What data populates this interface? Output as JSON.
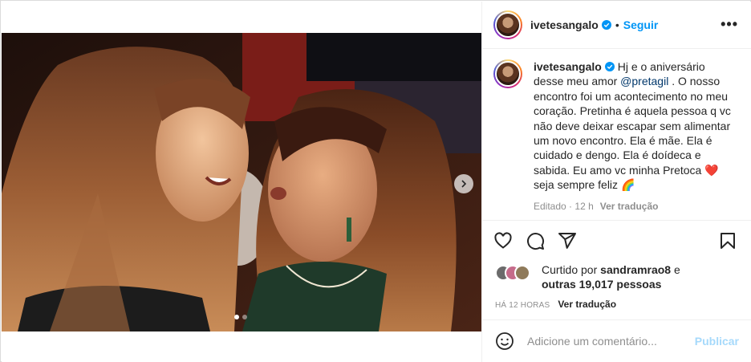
{
  "post": {
    "username": "ivetesangalo",
    "follow_label": "Seguir",
    "separator": "•",
    "more_label": "•••"
  },
  "caption": {
    "username": "ivetesangalo",
    "text_before_mention": "Hj e o aniversário desse meu amor ",
    "mention": "@pretagil",
    "text_after_mention": " . O nosso encontro foi um acontecimento no meu coração. Pretinha é aquela pessoa q vc não deve deixar escapar sem alimentar um novo encontro. Ela é mãe. Ela é cuidado e dengo. Ela é doídeca e sabida. Eu amo vc minha Pretoca ",
    "heart": "❤️",
    "text_end": " seja sempre feliz ",
    "rainbow": "🌈",
    "edited_label": "Editado",
    "edited_sep": "·",
    "time": "12 h",
    "translate_label": "Ver tradução"
  },
  "likes": {
    "prefix": "Curtido por ",
    "user": "sandramrao8",
    "connector": " e",
    "others": "outras 19,017 pessoas"
  },
  "timestamp": {
    "label": "HÁ 12 HORAS",
    "translate_label": "Ver tradução"
  },
  "comment_box": {
    "placeholder": "Adicione um comentário...",
    "publish_label": "Publicar"
  },
  "carousel": {
    "slide_count": 2,
    "active_index": 0
  },
  "colors": {
    "accent": "#0095f6",
    "mention": "#00376b",
    "secondary_text": "#8e8e8e",
    "heart": "#ed4956"
  }
}
